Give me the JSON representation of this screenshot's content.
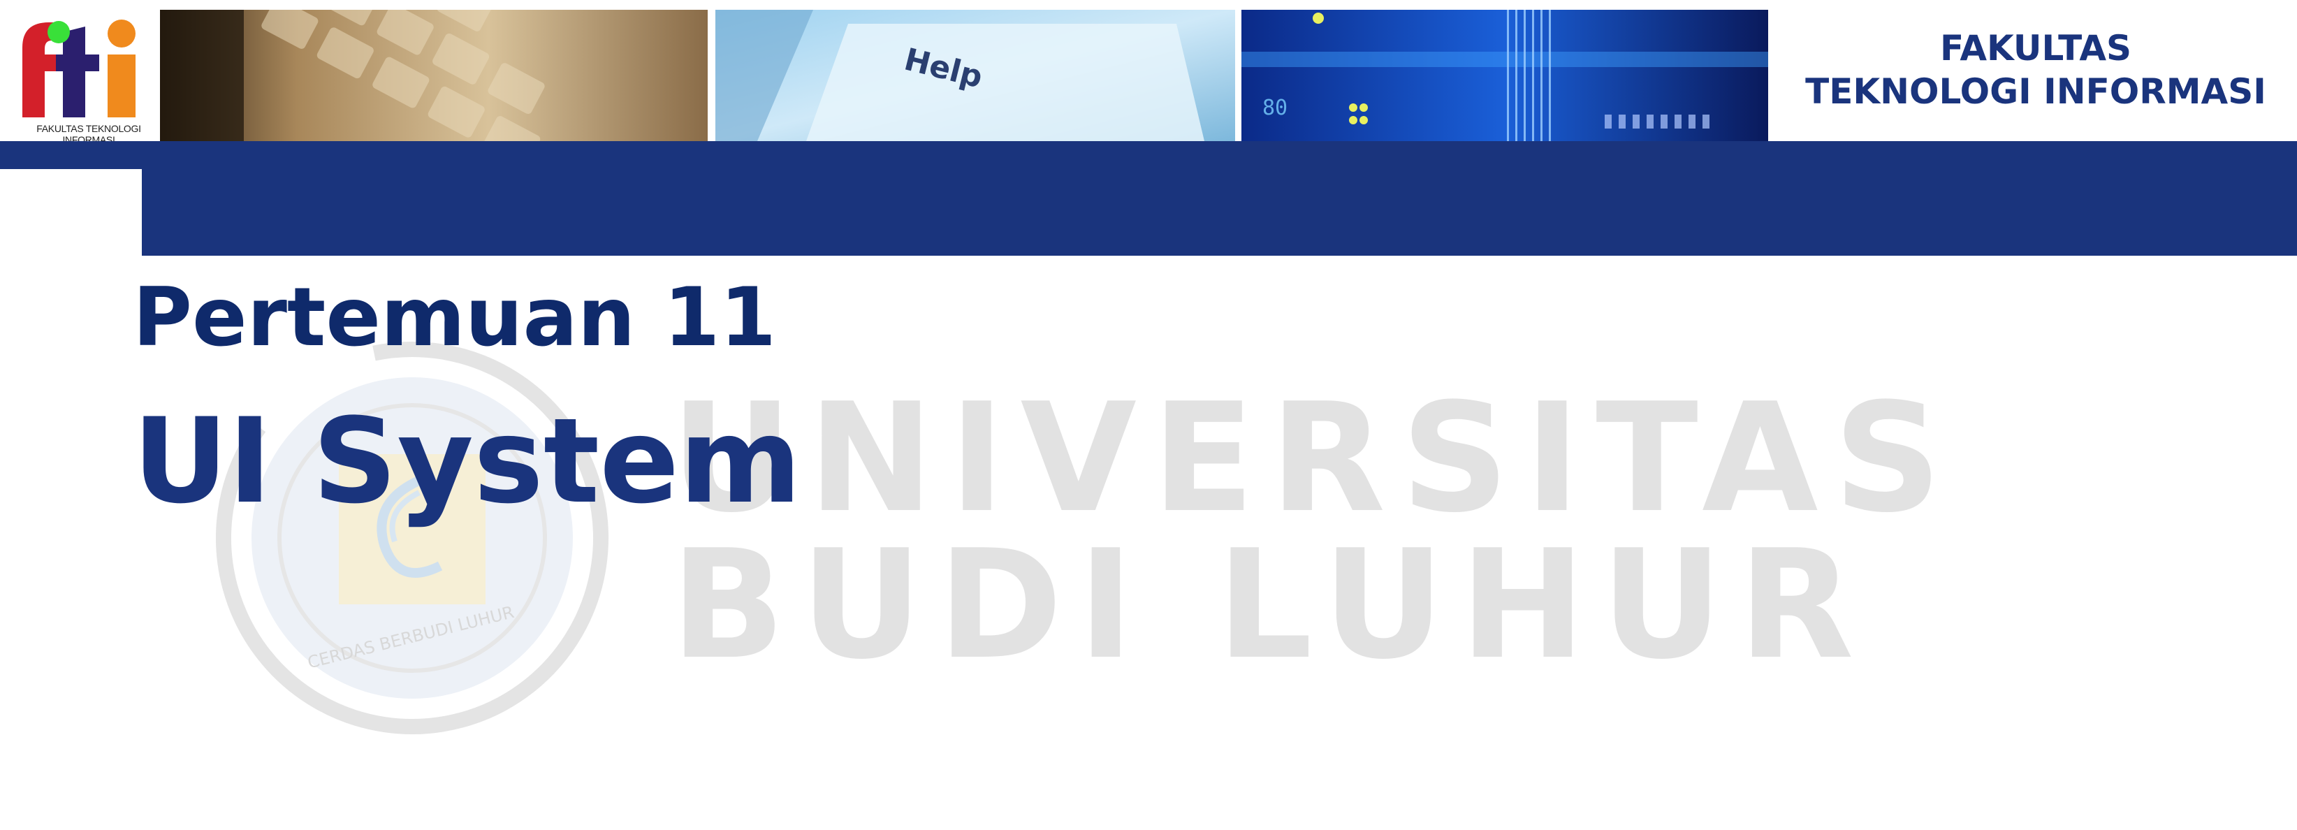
{
  "logo": {
    "caption": "FAKULTAS TEKNOLOGI INFORMASI",
    "colors": {
      "f": "#d3202a",
      "t": "#2b1f6e",
      "i": "#f08a1d",
      "dot": "#39e039"
    }
  },
  "header": {
    "faculty_line1": "FAKULTAS",
    "faculty_line2": "TEKNOLOGI INFORMASI",
    "photos": [
      "keyboard-photo",
      "help-key-photo",
      "circuit-board-photo"
    ],
    "help_key_label": "Help"
  },
  "watermark": {
    "line1": "UNIVERSITAS",
    "line2": "BUDI LUHUR",
    "seal_text": "CERDAS BERBUDI LUHUR"
  },
  "slide": {
    "subtitle": "Pertemuan 11",
    "title": "UI System"
  },
  "colors": {
    "brand_blue": "#1a347d",
    "watermark_gray": "#e2e2e2"
  }
}
